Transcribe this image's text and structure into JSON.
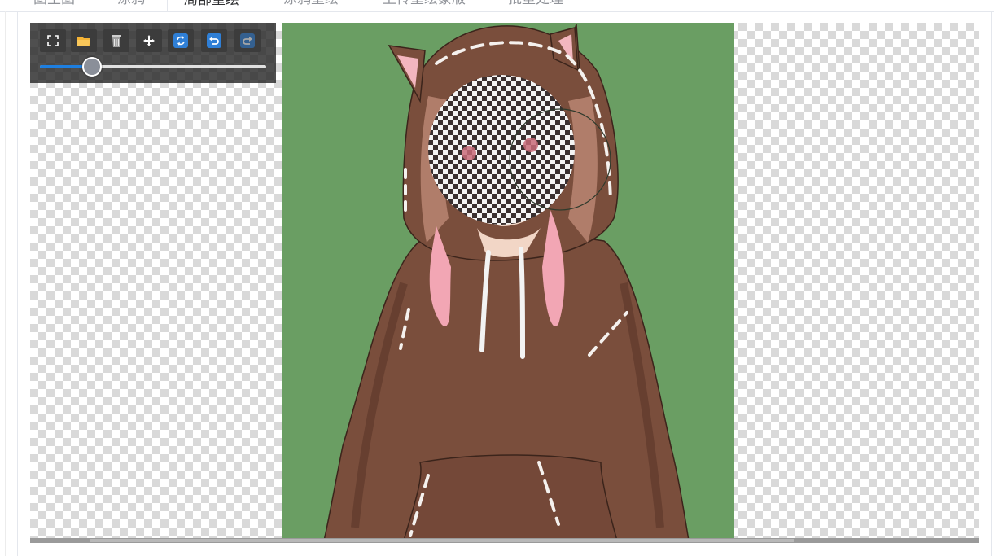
{
  "tabs": [
    {
      "label": "图生图",
      "active": false
    },
    {
      "label": "涂鸦",
      "active": false
    },
    {
      "label": "局部重绘",
      "active": true
    },
    {
      "label": "涂鸦重绘",
      "active": false
    },
    {
      "label": "上传重绘蒙版",
      "active": false
    },
    {
      "label": "批量处理",
      "active": false
    }
  ],
  "toolbar": {
    "buttons": [
      {
        "name": "fullscreen-button",
        "icon": "fullscreen-icon"
      },
      {
        "name": "open-file-button",
        "icon": "folder-icon"
      },
      {
        "name": "clear-button",
        "icon": "trash-icon"
      },
      {
        "name": "move-button",
        "icon": "move-icon"
      },
      {
        "name": "reset-button",
        "icon": "refresh-icon"
      },
      {
        "name": "undo-button",
        "icon": "undo-icon"
      },
      {
        "name": "redo-button",
        "icon": "redo-icon"
      }
    ],
    "brush_size_fraction": 0.23
  },
  "colors": {
    "accent": "#1e7fe0",
    "image_background": "#6a9e63",
    "hoodie": "#7a4e3c",
    "hair_pink": "#f2a6b4"
  }
}
